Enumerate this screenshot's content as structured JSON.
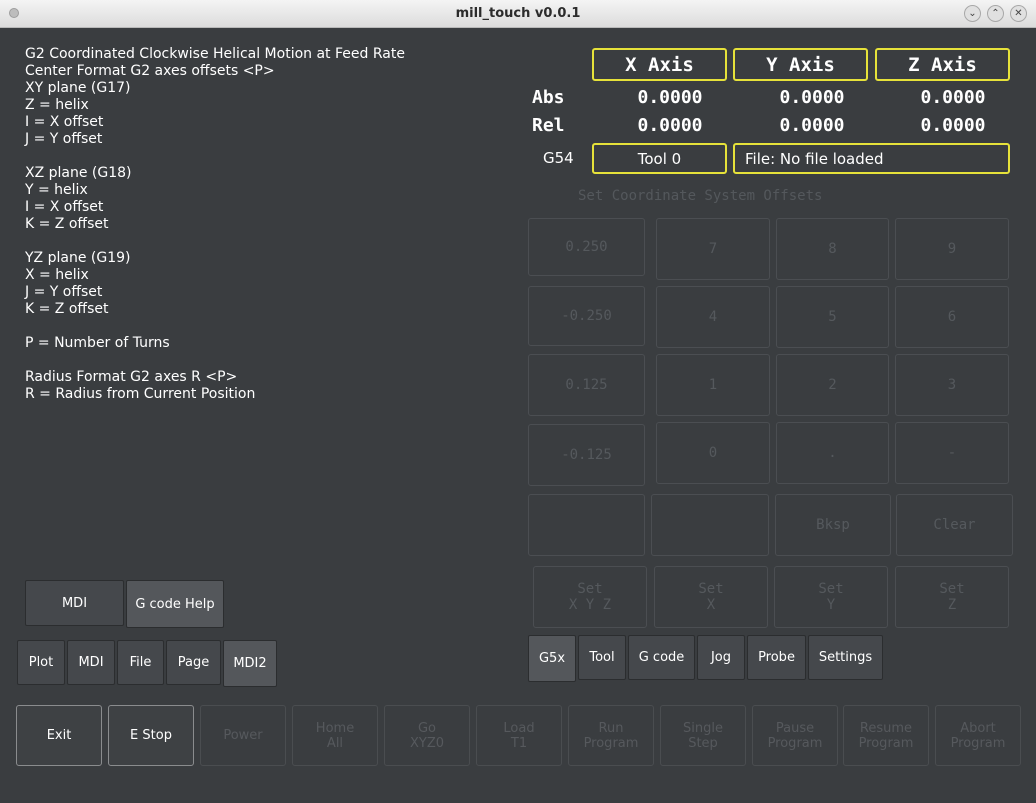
{
  "window": {
    "title": "mill_touch v0.0.1",
    "min_glyph": "⌄",
    "max_glyph": "⌃",
    "close_glyph": "✕"
  },
  "help": {
    "lines": [
      "G2 Coordinated Clockwise Helical Motion at Feed Rate",
      "Center Format G2 axes offsets <P>",
      "XY plane (G17)",
      "Z = helix",
      "I = X offset",
      "J = Y offset",
      "",
      "XZ plane (G18)",
      "Y = helix",
      "I = X offset",
      "K = Z offset",
      "",
      "YZ plane (G19)",
      "X = helix",
      "J = Y offset",
      "K = Z offset",
      "",
      "P = Number of Turns",
      "",
      "Radius Format G2 axes R <P>",
      "R = Radius from Current Position"
    ]
  },
  "left_buttons": {
    "mdi": "MDI",
    "gcode_help": "G code Help"
  },
  "left_tabs": [
    "Plot",
    "MDI",
    "File",
    "Page",
    "MDI2"
  ],
  "dro": {
    "axes": [
      "X Axis",
      "Y Axis",
      "Z Axis"
    ],
    "abs_label": "Abs",
    "rel_label": "Rel",
    "abs": [
      "0.0000",
      "0.0000",
      "0.0000"
    ],
    "rel": [
      "0.0000",
      "0.0000",
      "0.0000"
    ],
    "coord_system": "G54",
    "tool": "Tool 0",
    "file": "File: No file loaded"
  },
  "keypad": {
    "title": "Set Coordinate System Offsets",
    "rows": [
      [
        "0.250",
        "7",
        "8",
        "9"
      ],
      [
        "-0.250",
        "4",
        "5",
        "6"
      ],
      [
        "0.125",
        "1",
        "2",
        "3"
      ],
      [
        "-0.125",
        "0",
        ".",
        "-"
      ],
      [
        "",
        "",
        "Bksp",
        "Clear"
      ]
    ],
    "set_buttons": [
      [
        "Set",
        "X Y Z"
      ],
      [
        "Set",
        "X"
      ],
      [
        "Set",
        "Y"
      ],
      [
        "Set",
        "Z"
      ]
    ]
  },
  "right_tabs": [
    "G5x",
    "Tool",
    "G code",
    "Jog",
    "Probe",
    "Settings"
  ],
  "bottom": {
    "exit": "Exit",
    "estop": "E Stop",
    "power": "Power",
    "disabled": [
      [
        "Home",
        "All"
      ],
      [
        "Go",
        "XYZ0"
      ],
      [
        "Load",
        "T1"
      ],
      [
        "Run",
        "Program"
      ],
      [
        "Single",
        "Step"
      ],
      [
        "Pause",
        "Program"
      ],
      [
        "Resume",
        "Program"
      ],
      [
        "Abort",
        "Program"
      ]
    ]
  },
  "colors": {
    "accent_yellow": "#e6e23a",
    "background": "#3a3d40"
  }
}
